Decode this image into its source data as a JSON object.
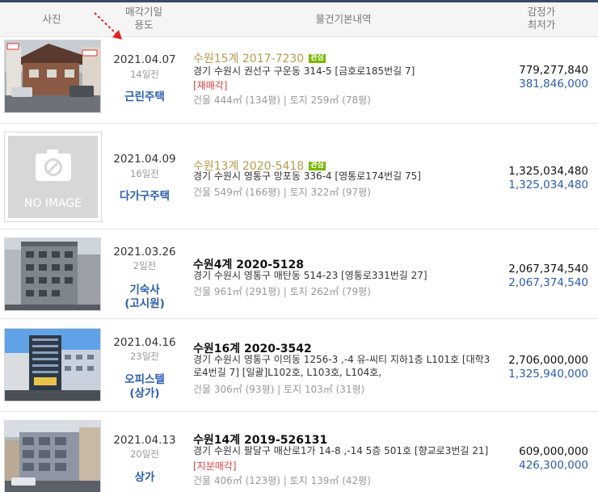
{
  "header": {
    "photo": "사진",
    "date_line1": "매각기일",
    "date_line2": "용도",
    "info": "물건기본내역",
    "price_line1": "감정가",
    "price_line2": "최저가"
  },
  "items": [
    {
      "thumb": "photo",
      "date": "2021.04.07",
      "ago": "14일전",
      "usage": "근린주택",
      "case_no": "수원15계 2017-7230",
      "badge": "관심",
      "addr": "경기 수원시 권선구 구운동 314-5 [금호로185번길 7]",
      "tag": "[재매각]",
      "area": "건물 444㎡ (134평)  |  토지 259㎡ (78평)",
      "appraised": "779,277,840",
      "min_price": "381,846,000"
    },
    {
      "thumb": "noimage",
      "no_image_label": "NO IMAGE",
      "date": "2021.04.09",
      "ago": "16일전",
      "usage": "다가구주택",
      "case_no": "수원13계 2020-5418",
      "badge": "관심",
      "addr": "경기 수원시 영통구 망포동 336-4 [영통로174번길 75]",
      "area": "건물 549㎡ (166평)  |  토지 322㎡ (97평)",
      "appraised": "1,325,034,480",
      "min_price": "1,325,034,480"
    },
    {
      "thumb": "photo",
      "date": "2021.03.26",
      "ago": "2일전",
      "usage_line1": "기숙사",
      "usage_line2": "(고시원)",
      "case_no": "수원4계 2020-5128",
      "addr": "경기 수원시 영통구 매탄동 514-23 [영통로331번길 27]",
      "area": "건물 961㎡ (291평)  |  토지 262㎡ (79평)",
      "appraised": "2,067,374,540",
      "min_price": "2,067,374,540"
    },
    {
      "thumb": "photo",
      "date": "2021.04.16",
      "ago": "23일전",
      "usage_line1": "오피스텔",
      "usage_line2": "(상가)",
      "case_no": "수원16계 2020-3542",
      "addr": "경기 수원시 영통구 이의동 1256-3 ,-4 유-씨티 지하1층 L101호 [대학3로4번길 7] [일괄]L102호, L103호, L104호,",
      "area": "건물 306㎡ (93평)  |  토지 103㎡ (31평)",
      "appraised": "2,706,000,000",
      "min_price": "1,325,940,000"
    },
    {
      "thumb": "photo",
      "date": "2021.04.13",
      "ago": "20일전",
      "usage": "상가",
      "case_no": "수원14계 2019-526131",
      "addr": "경기 수원시 팔달구 매산로1가 14-8 ,-14 5층 501호 [향교로3번길 21]",
      "tag": "[지분매각]",
      "area": "건물 406㎡ (123평)  |  토지 139㎡ (42평)",
      "appraised": "609,000,000",
      "min_price": "426,300,000"
    }
  ],
  "colors": {
    "case_gold": "#b89a4e",
    "usage_blue": "#2a5db0",
    "tag_red": "#e23b3b",
    "badge_green": "#7ab800"
  }
}
